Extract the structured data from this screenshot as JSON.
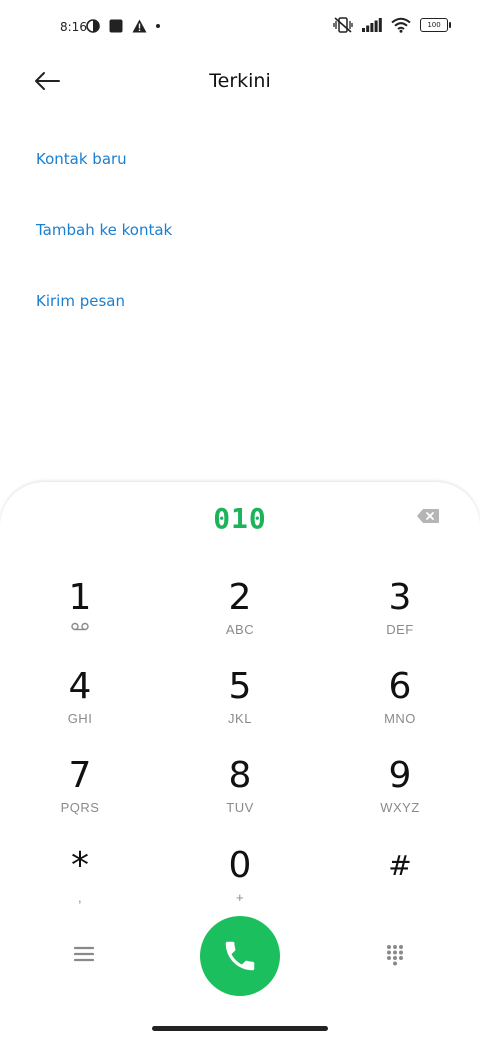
{
  "status": {
    "time": "8:16",
    "battery": "100"
  },
  "header": {
    "title": "Terkini"
  },
  "menu": {
    "items": [
      "Kontak baru",
      "Tambah ke kontak",
      "Kirim pesan"
    ]
  },
  "dialer": {
    "number": "010",
    "keys": [
      {
        "digit": "1",
        "letters": ""
      },
      {
        "digit": "2",
        "letters": "ABC"
      },
      {
        "digit": "3",
        "letters": "DEF"
      },
      {
        "digit": "4",
        "letters": "GHI"
      },
      {
        "digit": "5",
        "letters": "JKL"
      },
      {
        "digit": "6",
        "letters": "MNO"
      },
      {
        "digit": "7",
        "letters": "PQRS"
      },
      {
        "digit": "8",
        "letters": "TUV"
      },
      {
        "digit": "9",
        "letters": "WXYZ"
      },
      {
        "digit": "*",
        "letters": ","
      },
      {
        "digit": "0",
        "letters": "+"
      },
      {
        "digit": "#",
        "letters": ""
      }
    ]
  },
  "colors": {
    "accent": "#1a7fd1",
    "call_green": "#1cbf5d",
    "number_green": "#1cb35a"
  }
}
